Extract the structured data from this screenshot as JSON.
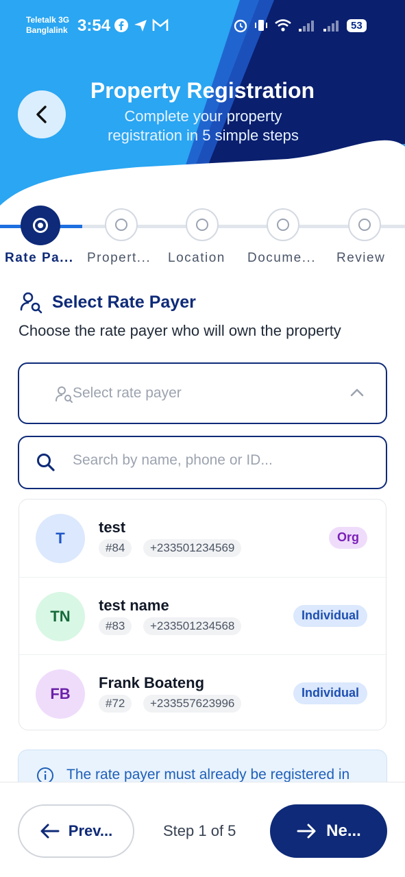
{
  "status_bar": {
    "carrier_1": "Teletalk 3G",
    "carrier_2": "Banglalink",
    "time": "3:54",
    "battery": "53"
  },
  "header": {
    "title": "Property Registration",
    "subtitle_line1": "Complete your property",
    "subtitle_line2": "registration in 5 simple steps",
    "colors": {
      "light_blue": "#2aa6f2",
      "dark_blue": "#0a1f6e"
    }
  },
  "stepper": {
    "steps": [
      {
        "label": "Rate Pa..."
      },
      {
        "label": "Propert..."
      },
      {
        "label": "Location"
      },
      {
        "label": "Docume..."
      },
      {
        "label": "Review"
      }
    ],
    "active_index": 0
  },
  "section": {
    "title": "Select Rate Payer",
    "description": "Choose the rate payer who will own the property"
  },
  "select": {
    "placeholder": "Select rate payer",
    "icon": "chevron-up-icon"
  },
  "search": {
    "placeholder": "Search by name, phone or ID..."
  },
  "rate_payers": [
    {
      "initials": "T",
      "name": "test",
      "id": "#84",
      "phone": "+233501234569",
      "type": "Org",
      "avatar_bg": "#dbe8fd",
      "avatar_fg": "#1e56c8",
      "badge_bg": "#efdcfb",
      "badge_fg": "#7a1fb8"
    },
    {
      "initials": "TN",
      "name": "test name",
      "id": "#83",
      "phone": "+233501234568",
      "type": "Individual",
      "avatar_bg": "#d8f7e4",
      "avatar_fg": "#166b3a",
      "badge_bg": "#dbe8fd",
      "badge_fg": "#1e4fb0"
    },
    {
      "initials": "FB",
      "name": "Frank Boateng",
      "id": "#72",
      "phone": "+233557623996",
      "type": "Individual",
      "avatar_bg": "#efdcfb",
      "avatar_fg": "#6b21a8",
      "badge_bg": "#dbe8fd",
      "badge_fg": "#1e4fb0"
    }
  ],
  "info": {
    "text": "The rate payer must already be registered in"
  },
  "footer": {
    "prev_label": "Prev...",
    "step_text": "Step 1 of 5",
    "next_label": "Ne..."
  }
}
